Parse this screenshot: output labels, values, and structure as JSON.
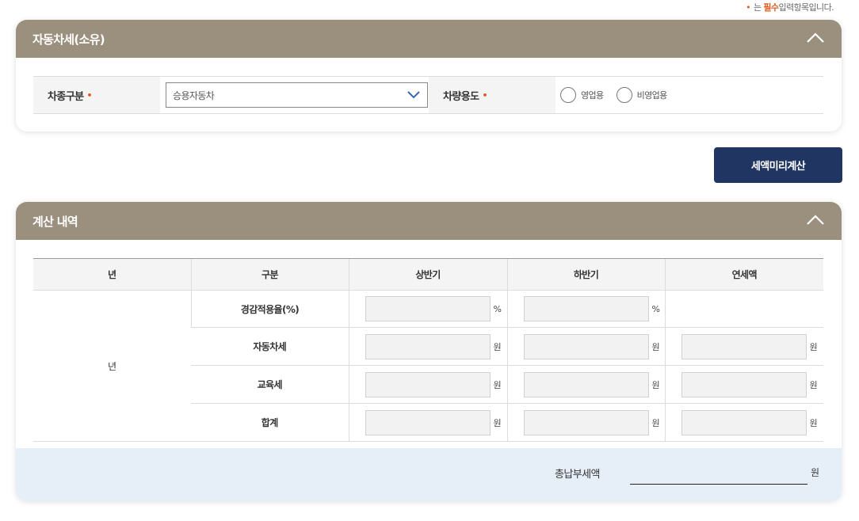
{
  "required_note": {
    "bullet": "•",
    "prefix": "는",
    "emphasis": "필수",
    "suffix": "입력항목입니다."
  },
  "ownership_panel": {
    "title": "자동차세(소유)",
    "toggle_icon": "chevron-up-icon",
    "vehicle_type": {
      "label": "차종구분",
      "required_mark": "•",
      "selected": "승용자동차",
      "dropdown_icon": "chevron-down-icon"
    },
    "vehicle_use": {
      "label": "차량용도",
      "required_mark": "•",
      "options": [
        "영업용",
        "비영업용"
      ]
    }
  },
  "calculate_button": "세액미리계산",
  "result_panel": {
    "title": "계산 내역",
    "toggle_icon": "chevron-up-icon",
    "columns": [
      "년",
      "구분",
      "상반기",
      "하반기",
      "연세액"
    ],
    "year_cell": "년",
    "rows": [
      {
        "label": "경감적용율(%)",
        "first_unit": "%",
        "second_unit": "%",
        "annual_unit": ""
      },
      {
        "label": "자동차세",
        "first_unit": "원",
        "second_unit": "원",
        "annual_unit": "원"
      },
      {
        "label": "교육세",
        "first_unit": "원",
        "second_unit": "원",
        "annual_unit": "원"
      },
      {
        "label": "합계",
        "first_unit": "원",
        "second_unit": "원",
        "annual_unit": "원"
      }
    ],
    "total": {
      "label": "총납부세액",
      "value": "",
      "unit": "원"
    }
  },
  "colors": {
    "panel_header": "#9b8f7d",
    "primary_button": "#213562",
    "required_accent": "#e05a1f",
    "total_bar": "#e6eff8",
    "input_fill": "#f2f2f2"
  }
}
